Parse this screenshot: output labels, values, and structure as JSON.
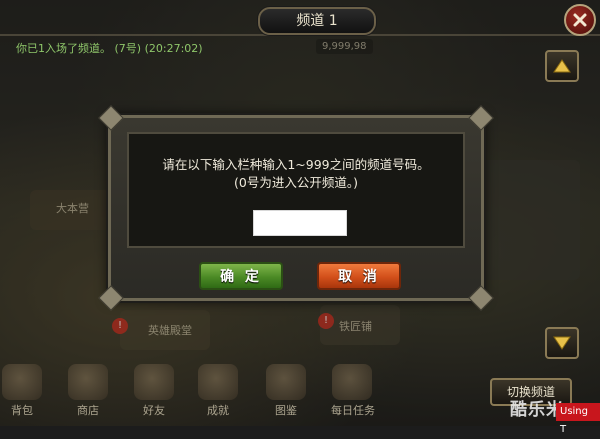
{
  "header": {
    "channel_title": "频道 1"
  },
  "chat": {
    "system_message": "你已1入场了频道。 (7号) (20:27:02)",
    "gold_amount": "9,999,98"
  },
  "dialog": {
    "prompt_line1": "请在以下输入栏种输入1~999之间的频道号码。",
    "prompt_line2": "(0号为进入公开频道。)",
    "input_value": "",
    "confirm_label": "确 定",
    "cancel_label": "取 消"
  },
  "scene": {
    "label_a": "大本营",
    "label_b": "英雄殿堂",
    "label_c": "铁匠铺"
  },
  "bottom_nav": [
    {
      "label": "背包",
      "icon": "bag-icon"
    },
    {
      "label": "商店",
      "icon": "shop-icon"
    },
    {
      "label": "好友",
      "icon": "friends-icon"
    },
    {
      "label": "成就",
      "icon": "achievement-icon"
    },
    {
      "label": "图鉴",
      "icon": "book-icon"
    },
    {
      "label": "每日任务",
      "icon": "quest-icon"
    }
  ],
  "switch_channel_label": "切换频道",
  "watermark": {
    "text": "酷乐米",
    "tag": "Using T"
  },
  "colors": {
    "confirm": "#4b8a25",
    "cancel": "#d24f1a",
    "system_text": "#8fc66a",
    "frame": "#6f6955"
  }
}
